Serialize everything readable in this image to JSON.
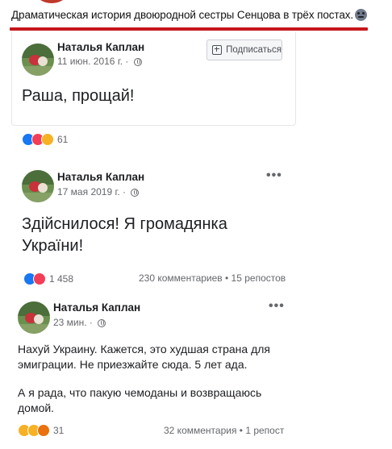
{
  "header": {
    "title": "Драматическая история двоюродной сестры Сенцова в трёх постах.",
    "emoji_icon": "unamused-face-emoji",
    "underline_color": "#c7161d"
  },
  "posts": [
    {
      "author": "Наталья Каплан",
      "date": "11 июн. 2016 г. · ",
      "subscribe_label": "Подписаться",
      "text": "Раша, прощай!",
      "reactions_count": "61",
      "reaction_icons": [
        "like",
        "love",
        "wow"
      ]
    },
    {
      "author": "Наталья Каплан",
      "date": "17 мая 2019 г. · ",
      "more": "•••",
      "text_line1": "Здійснилося! Я громадянка",
      "text_line2": "України!",
      "reactions_count": "1 458",
      "reaction_icons": [
        "like",
        "love"
      ],
      "stats": "230 комментариев • 15 репостов"
    },
    {
      "author": "Наталья Каплан",
      "date": "23 мин. · ",
      "more": "•••",
      "text_line1": "Нахуй Украину. Кажется, это худшая страна для",
      "text_line2": "эмиграции. Не приезжайте сюда. 5 лет ада.",
      "text_line3": "А я рада, что пакую чемоданы и возвращаюсь",
      "text_line4": "домой.",
      "reactions_count": "31",
      "reaction_icons": [
        "wow",
        "sad",
        "angry"
      ],
      "stats": "32 комментария • 1 репост"
    }
  ]
}
